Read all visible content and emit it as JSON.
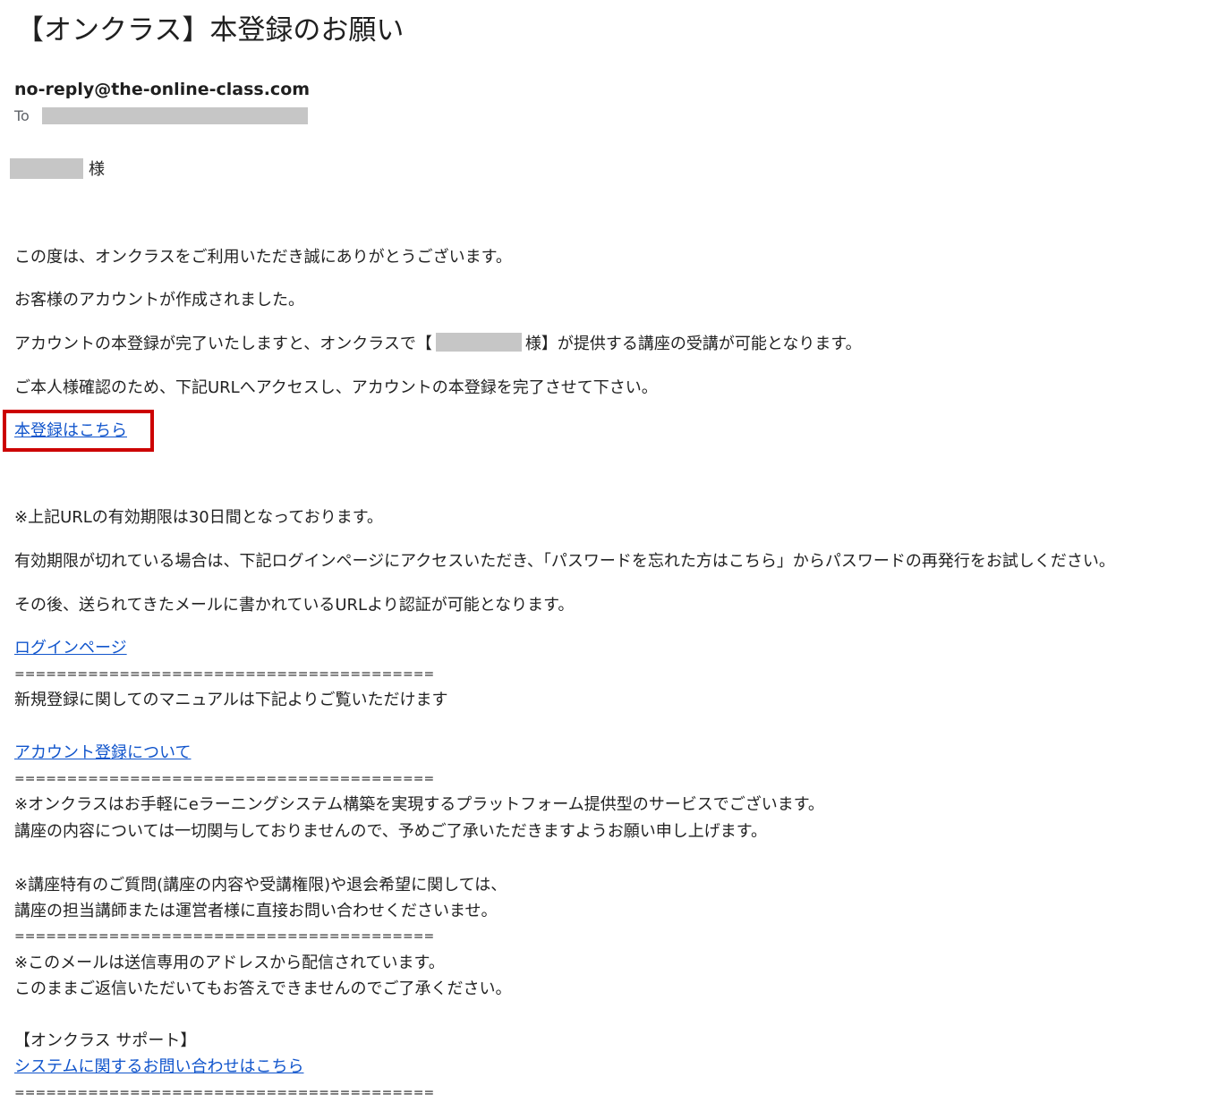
{
  "email": {
    "subject": "【オンクラス】本登録のお願い",
    "sender": "no-reply@the-online-class.com",
    "to_label": "To",
    "salutation_suffix": "様"
  },
  "body": {
    "p1": "この度は、オンクラスをご利用いただき誠にありがとうございます。",
    "p2": "お客様のアカウントが作成されました。",
    "p3_before": "アカウントの本登録が完了いたしますと、オンクラスで【",
    "p3_after": "様】が提供する講座の受講が可能となります。",
    "p4": "ご本人様確認のため、下記URLへアクセスし、アカウントの本登録を完了させて下さい。",
    "register_link": "本登録はこちら",
    "note1": "※上記URLの有効期限は30日間となっております。",
    "note2": "有効期限が切れている場合は、下記ログインページにアクセスいただき、「パスワードを忘れた方はこちら」からパスワードの再発行をお試しください。",
    "note3": "その後、送られてきたメールに書かれているURLより認証が可能となります。",
    "login_link": "ログインページ",
    "separator": "========================================",
    "manual_text": "新規登録に関してのマニュアルは下記よりご覧いただけます",
    "account_link": "アカウント登録について",
    "disclaimer1": "※オンクラスはお手軽にeラーニングシステム構築を実現するプラットフォーム提供型のサービスでございます。",
    "disclaimer2": "講座の内容については一切関与しておりませんので、予めご了承いただきますようお願い申し上げます。",
    "question1": "※講座特有のご質問(講座の内容や受講権限)や退会希望に関しては、",
    "question2": "講座の担当講師または運営者様に直接お問い合わせくださいませ。",
    "noreply1": "※このメールは送信専用のアドレスから配信されています。",
    "noreply2": "このままご返信いただいてもお答えできませんのでご了承ください。",
    "support_title": "【オンクラス サポート】",
    "support_link": "システムに関するお問い合わせはこちら"
  },
  "colors": {
    "link": "#1155cc",
    "highlight": "#cc0000",
    "redaction": "#c6c6c6"
  }
}
